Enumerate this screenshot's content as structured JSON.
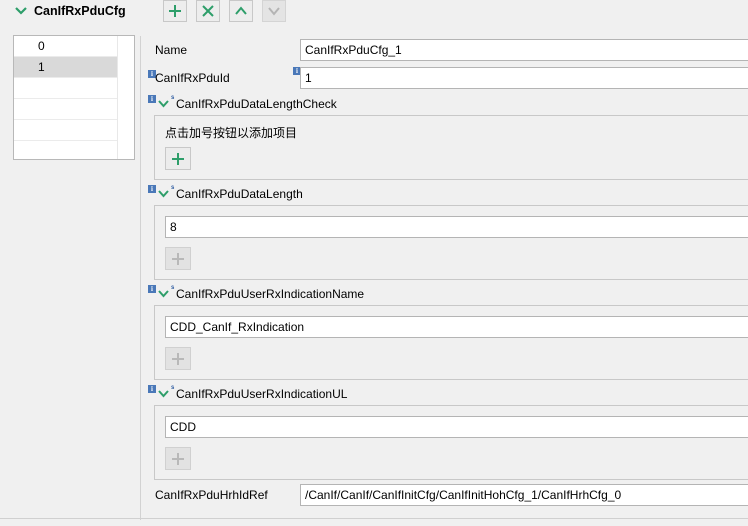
{
  "header": {
    "title": "CanIfRxPduCfg",
    "buttons": [
      {
        "name": "add",
        "icon": "plus-icon",
        "enabled": true
      },
      {
        "name": "delete",
        "icon": "close-icon",
        "enabled": true
      },
      {
        "name": "move-up",
        "icon": "chevron-up-icon",
        "enabled": true
      },
      {
        "name": "move-down",
        "icon": "chevron-down-icon",
        "enabled": false
      }
    ]
  },
  "list": {
    "items": [
      {
        "label": "0",
        "selected": false
      },
      {
        "label": "1",
        "selected": true
      }
    ]
  },
  "form": {
    "name_label": "Name",
    "name_value": "CanIfRxPduCfg_1",
    "pdu_id_label": "CanIfRxPduId",
    "pdu_id_value": "1",
    "dlc_check_label": "CanIfRxPduDataLengthCheck",
    "dlc_check_hint": "点击加号按钮以添加项目",
    "data_length_label": "CanIfRxPduDataLength",
    "data_length_value": "8",
    "indication_name_label": "CanIfRxPduUserRxIndicationName",
    "indication_name_value": "CDD_CanIf_RxIndication",
    "indication_ul_label": "CanIfRxPduUserRxIndicationUL",
    "indication_ul_value": "CDD",
    "hrh_ref_label": "CanIfRxPduHrhIdRef",
    "hrh_ref_value": "/CanIf/CanIf/CanIfInitCfg/CanIfInitHohCfg_1/CanIfHrhCfg_0"
  },
  "colors": {
    "accent_green": "#2e9e6a",
    "info_blue": "#4a78b8",
    "selected_row": "#d9d9d9",
    "background": "#f0f0f0"
  }
}
